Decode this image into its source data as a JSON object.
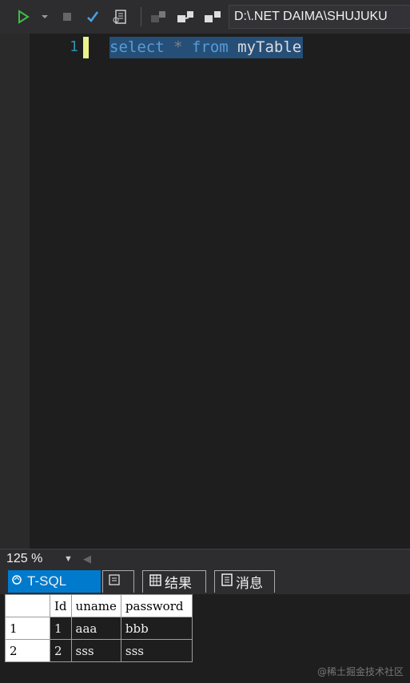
{
  "toolbar": {
    "path": "D:\\.NET DAIMA\\SHUJUKU"
  },
  "editor": {
    "line_number": "1",
    "code": {
      "kw1": "select",
      "op": " * ",
      "kw2": "from",
      "ident": " myTable"
    }
  },
  "status": {
    "zoom": "125 %"
  },
  "tabs": {
    "tsql": "T-SQL",
    "results": "结果",
    "messages": "消息"
  },
  "grid": {
    "headers": [
      "Id",
      "uname",
      "password"
    ],
    "rows": [
      {
        "rownum": "1",
        "cells": [
          "1",
          "aaa",
          "bbb"
        ]
      },
      {
        "rownum": "2",
        "cells": [
          "2",
          "sss",
          "sss"
        ]
      }
    ]
  },
  "watermark": "@稀土掘金技术社区"
}
